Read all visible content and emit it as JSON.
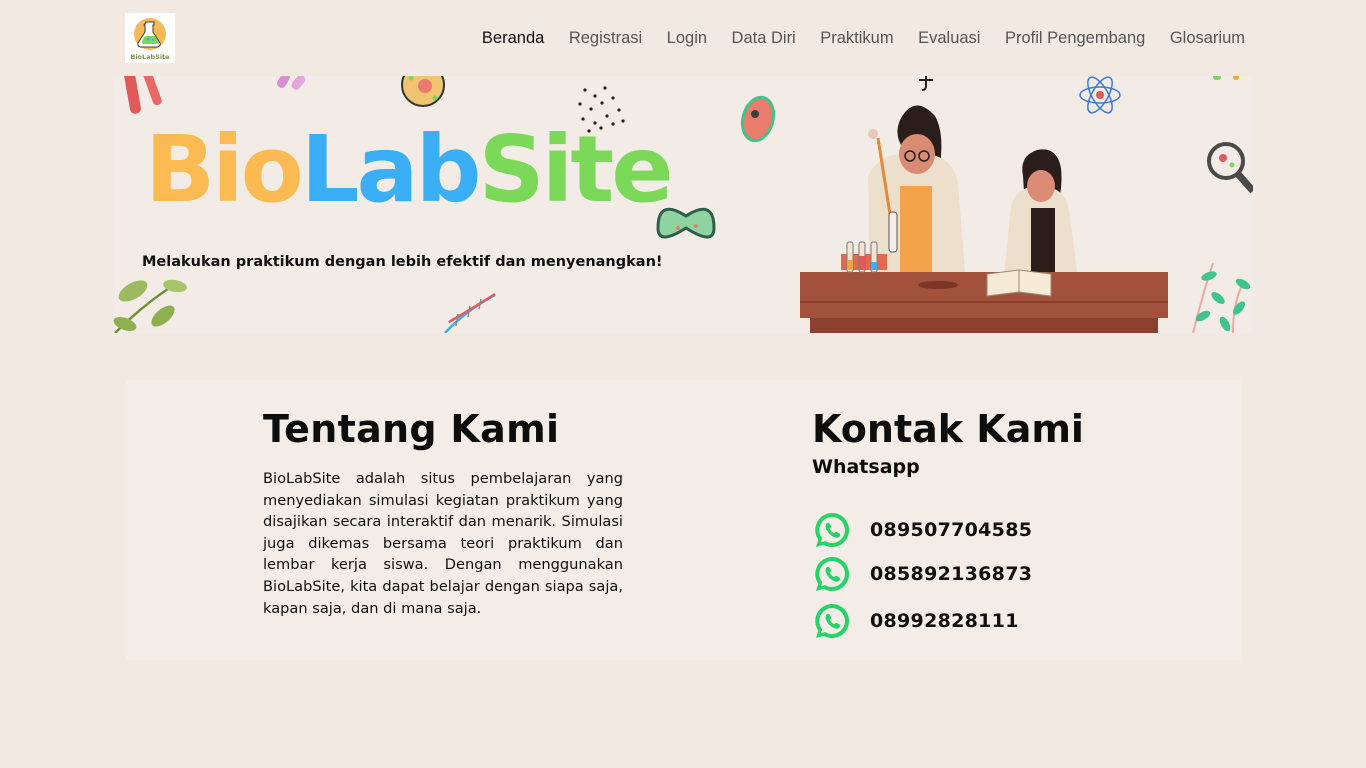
{
  "nav": {
    "logo_text": "BioLabSite",
    "items": [
      {
        "label": "Beranda"
      },
      {
        "label": "Registrasi"
      },
      {
        "label": "Login"
      },
      {
        "label": "Data Diri"
      },
      {
        "label": "Praktikum"
      },
      {
        "label": "Evaluasi"
      },
      {
        "label": "Profil Pengembang"
      },
      {
        "label": "Glosarium"
      }
    ]
  },
  "banner": {
    "title_parts": [
      "Bio",
      "Lab",
      "Site"
    ],
    "tagline": "Melakukan praktikum dengan lebih efektif dan menyenangkan!"
  },
  "about": {
    "title": "Tentang Kami",
    "text": "BioLabSite adalah situs pembelajaran yang menyediakan simulasi kegiatan praktikum yang disajikan secara interaktif dan menarik. Simulasi juga dikemas bersama teori praktikum dan lembar kerja siswa. Dengan menggunakan BioLabSite, kita dapat belajar dengan siapa saja, kapan saja, dan di mana saja."
  },
  "contact": {
    "title": "Kontak Kami",
    "subtitle": "Whatsapp",
    "phones": [
      "089507704585",
      "085892136873",
      "08992828111"
    ]
  },
  "colors": {
    "background": "#f2e9e3",
    "bio_yellow": "#fbbb52",
    "lab_blue": "#3aaff5",
    "site_green": "#7bd858",
    "whatsapp_green": "#25d366"
  }
}
